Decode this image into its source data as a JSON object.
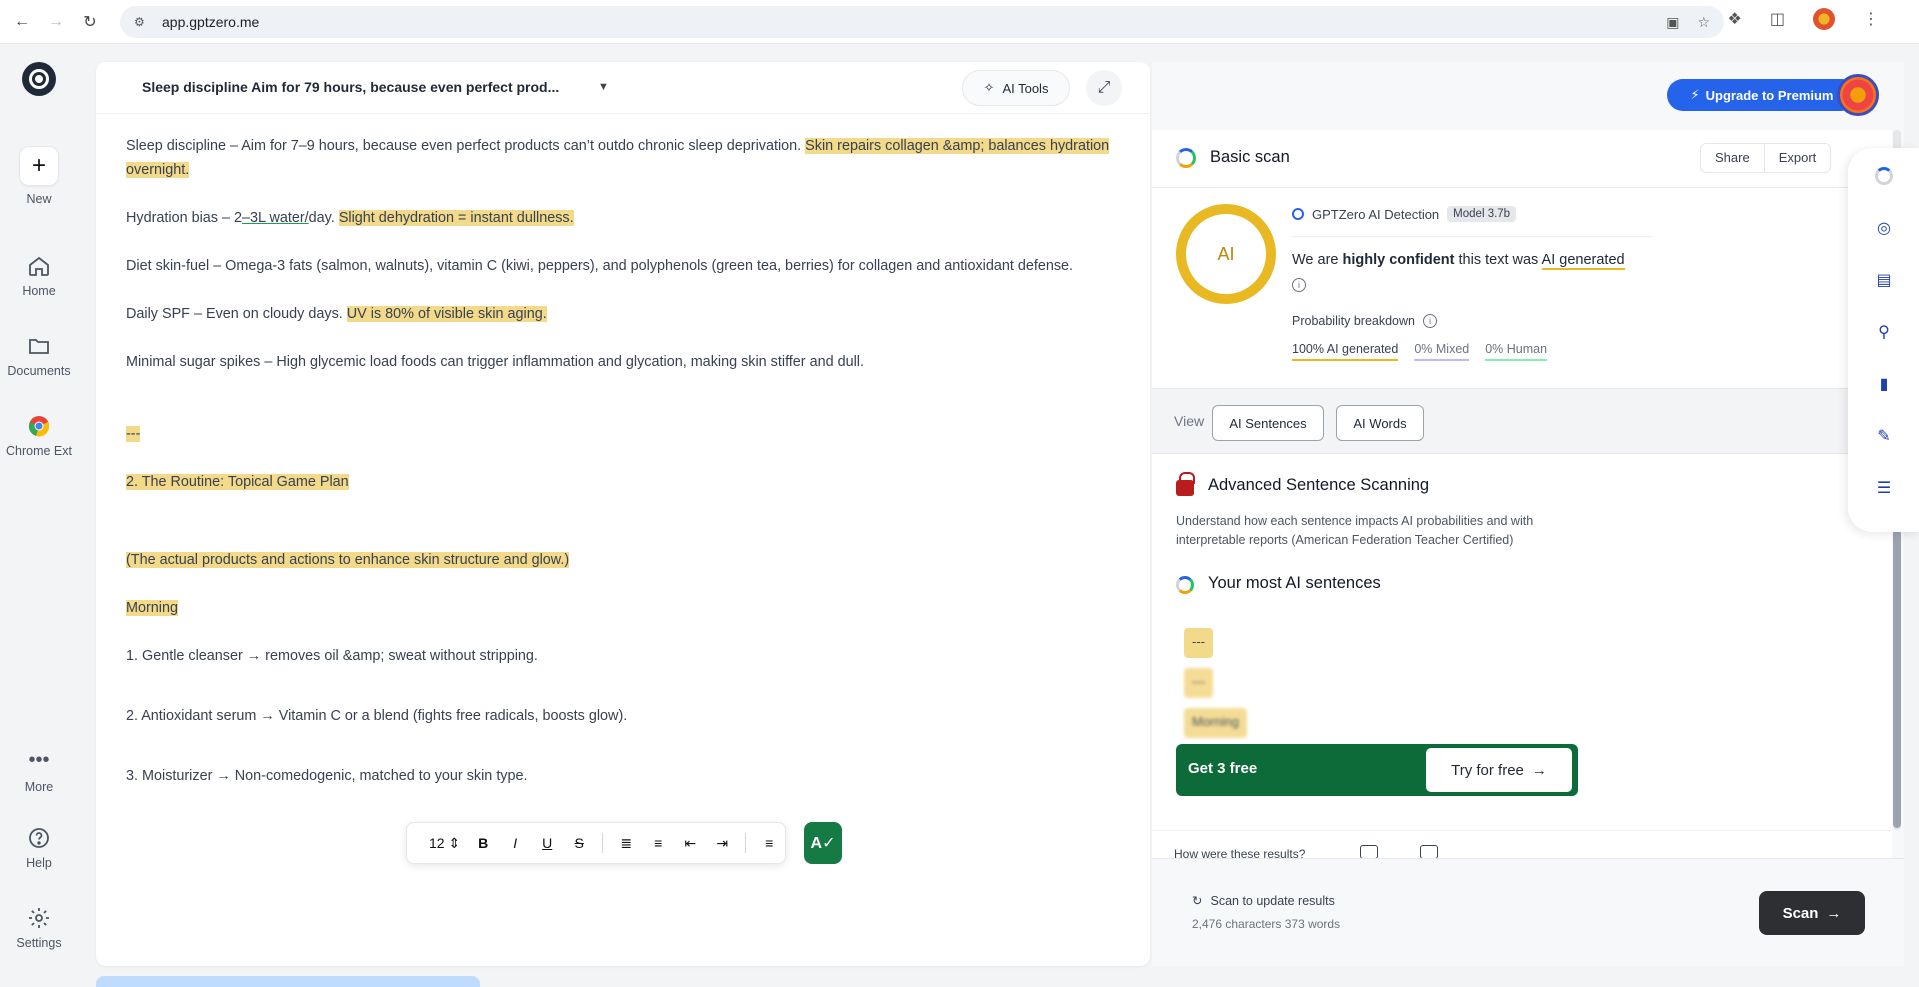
{
  "browser": {
    "url": "app.gptzero.me"
  },
  "sidebar": {
    "items": [
      {
        "label": "New",
        "icon": "plus-icon"
      },
      {
        "label": "Home",
        "icon": "home-icon"
      },
      {
        "label": "Documents",
        "icon": "folder-icon"
      },
      {
        "label": "Chrome Ext",
        "icon": "chrome-icon"
      },
      {
        "label": "More",
        "icon": "more-icon"
      },
      {
        "label": "Help",
        "icon": "help-icon"
      },
      {
        "label": "Settings",
        "icon": "gear-icon"
      }
    ]
  },
  "editor": {
    "title": "Sleep discipline Aim for 79 hours, because even perfect prod...",
    "ai_tools_label": "AI Tools",
    "paragraphs": {
      "p1_plain": "Sleep discipline – Aim for 7–9 hours, because even perfect products can’t outdo chronic sleep deprivation.",
      "p1_hl": "Skin repairs collagen &amp; balances hydration overnight.",
      "p2_a": "Hydration bias – 2",
      "p2_b": "–3L water/",
      "p2_c": "day.",
      "p2_hl": "Slight dehydration = instant dullness.",
      "p3": "Diet skin-fuel – Omega-3 fats (salmon, walnuts), vitamin C (kiwi, peppers), and polyphenols (green tea, berries) for collagen and antioxidant defense.",
      "p4_plain": "Daily SPF – Even on cloudy days.",
      "p4_hl": "UV is 80% of visible skin aging.",
      "p5": "Minimal sugar spikes – High glycemic load foods can trigger inflammation and glycation, making skin stiffer and dull.",
      "p6_hl": "---",
      "p7_hl": "2. The Routine: Topical Game Plan",
      "p8_hl": "(The actual products and actions to enhance skin structure and glow.)",
      "p9_hl": "Morning",
      "p10": "1. Gentle cleanser → removes oil &amp; sweat without stripping.",
      "p11": "2. Antioxidant serum → Vitamin C or a blend (fights free radicals, boosts glow).",
      "p12": "3. Moisturizer → Non-comedogenic, matched to your skin type."
    },
    "format_bar": {
      "font_size": "12"
    }
  },
  "header_right": {
    "upgrade_label": "Upgrade to Premium"
  },
  "scan": {
    "title": "Basic scan",
    "share_label": "Share",
    "export_label": "Export",
    "ring_label": "AI",
    "detection_label": "GPTZero AI Detection",
    "model_label": "Model 3.7b",
    "verdict_pre": "We are",
    "verdict_bold": "highly confident",
    "verdict_mid": "this text was",
    "verdict_tag": "AI generated",
    "prob_label": "Probability breakdown",
    "prob_ai": "100% AI generated",
    "prob_mixed": "0% Mixed",
    "prob_human": "0% Human",
    "view_label": "View",
    "view_ai_sentences": "AI Sentences",
    "view_ai_words": "AI Words",
    "adv_title": "Advanced Sentence Scanning",
    "adv_desc": "Understand how each sentence impacts AI probabilities and with interpretable reports (American Federation Teacher Certified)",
    "most_title": "Your most AI sentences",
    "chips": [
      "---",
      "---",
      "Morning"
    ],
    "cta_text": "Get 3 free",
    "cta_button": "Try for free",
    "feedback_label": "How were these results?",
    "foot_status": "Scan to update results",
    "foot_counts": "2,476 characters 373 words",
    "scan_button": "Scan"
  },
  "colors": {
    "highlight": "#f3d98a",
    "ai_ring": "#e8b923",
    "primary_blue": "#2563eb",
    "cta_green": "#0d6b3a",
    "scan_button": "#2d2f33"
  }
}
